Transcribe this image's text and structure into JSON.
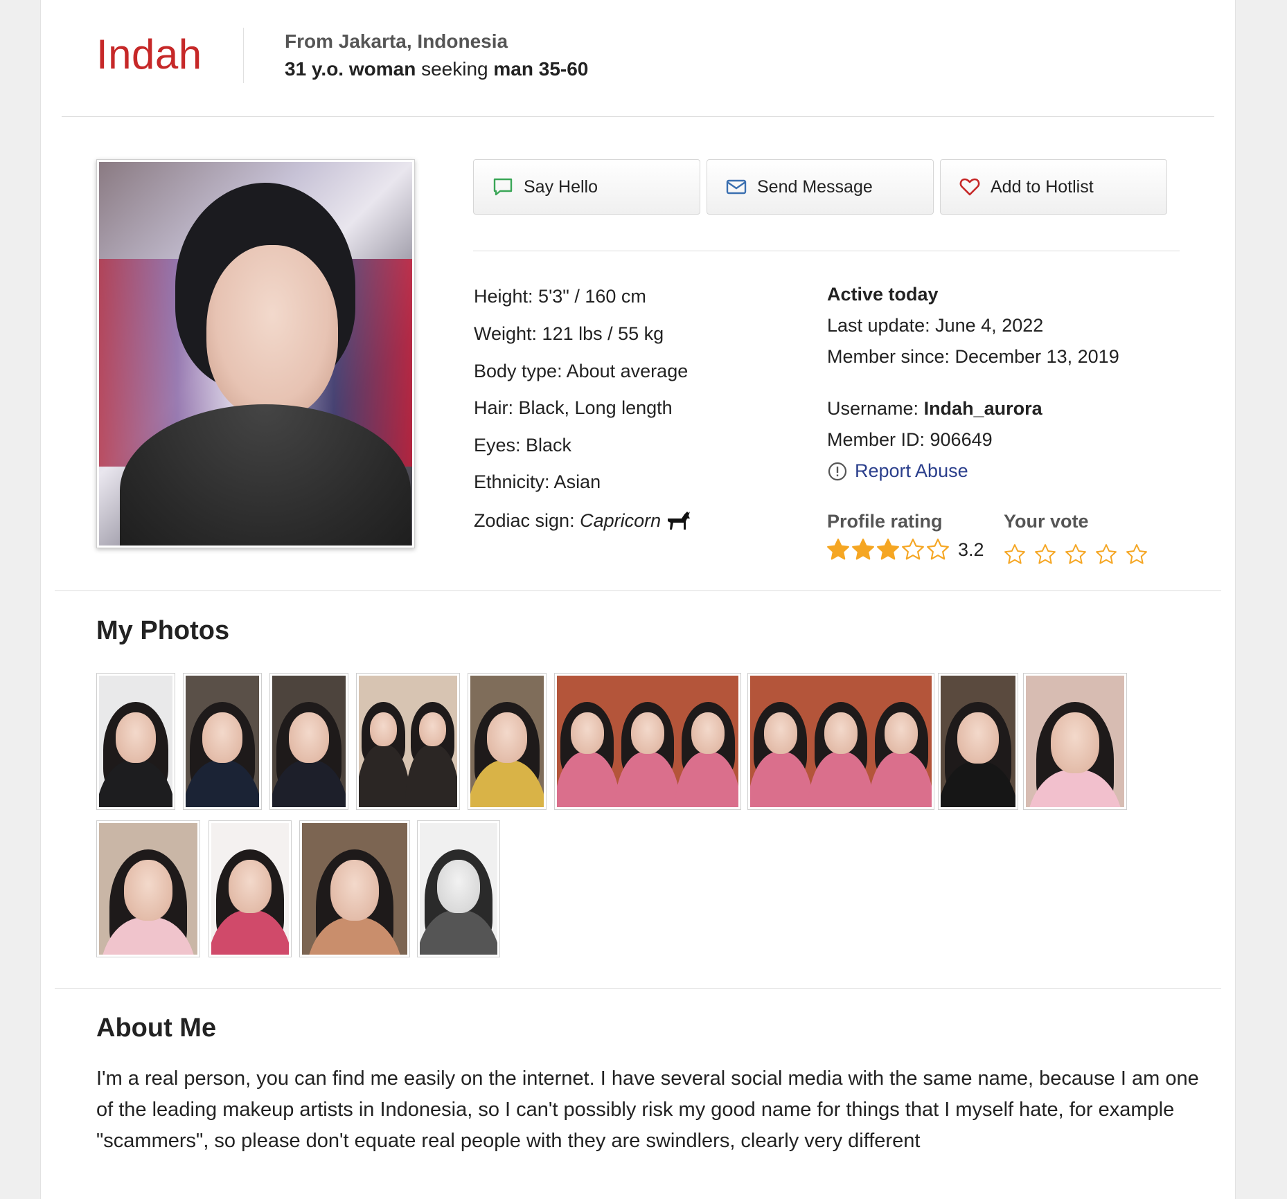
{
  "profile": {
    "name": "Indah",
    "from": "From Jakarta, Indonesia",
    "seeking": {
      "age": "31 y.o. woman",
      "verb": "seeking",
      "target": "man 35-60"
    },
    "main_photo_alt": "Indah"
  },
  "actions": {
    "say_hello": "Say Hello",
    "send_message": "Send Message",
    "add_hotlist": "Add to Hotlist"
  },
  "details": {
    "height": "Height: 5'3\" / 160 cm",
    "weight": "Weight: 121 lbs / 55 kg",
    "body_type": "Body type: About average",
    "hair": "Hair: Black, Long length",
    "eyes": "Eyes: Black",
    "ethnicity": "Ethnicity: Asian",
    "zodiac_label": "Zodiac sign:",
    "zodiac_value": "Capricorn"
  },
  "status": {
    "active": "Active today",
    "last_update": "Last update: June 4, 2022",
    "member_since": "Member since: December 13, 2019",
    "username_label": "Username:",
    "username_value": "Indah_aurora",
    "member_id": "Member ID: 906649",
    "report_abuse": "Report Abuse"
  },
  "rating": {
    "profile_rating_label": "Profile rating",
    "value": "3.2",
    "stars_filled_fraction": 0.64,
    "your_vote_label": "Your vote",
    "vote_stars": 5
  },
  "colors": {
    "name_red": "#c62828",
    "star_gold": "#f5a623",
    "link_blue": "#2b3f8c",
    "chat_green": "#3aa657",
    "mail_blue": "#3a6fb0",
    "heart_red": "#c62828"
  },
  "photos": {
    "title": "My Photos",
    "count": 13
  },
  "about": {
    "title": "About Me",
    "text": "I'm a real person, you can find me easily on the internet. I have several social media with the same name, because I am one of the leading makeup artists in Indonesia, so I can't possibly risk my good name for things that I myself hate, for example \"scammers\", so please don't equate real people with they are swindlers, clearly very different"
  }
}
